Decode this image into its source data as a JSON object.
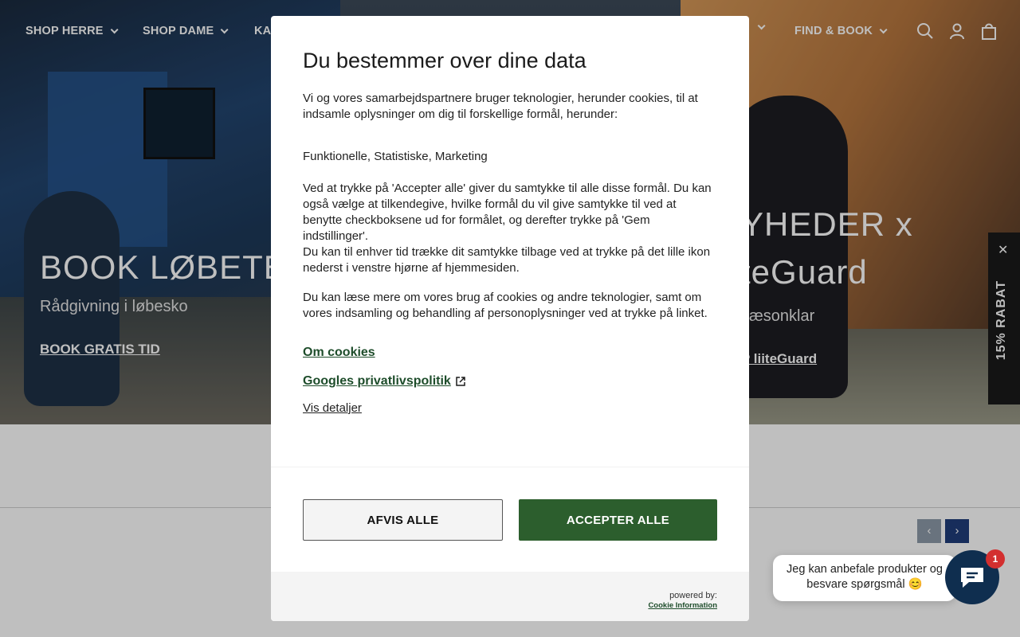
{
  "nav": {
    "items": [
      "SHOP HERRE",
      "SHOP DAME",
      "KA",
      "FIND & BOOK"
    ]
  },
  "hero": {
    "left": {
      "title": "BOOK LØBETES",
      "subtitle": "Rådgivning i løbesko",
      "link": "BOOK GRATIS TID"
    },
    "right": {
      "title_line1": "YHEDER x",
      "title_line2": "teGuard",
      "subtitle": "sæsonklar",
      "link": "P liiteGuard"
    }
  },
  "side_tab": {
    "label": "15% RABAT",
    "close": "✕"
  },
  "carousel": {
    "prev": "‹",
    "next": "›"
  },
  "chat": {
    "bubble": "Jeg kan anbefale produkter og besvare spørgsmål 😊",
    "badge": "1"
  },
  "consent": {
    "title": "Du bestemmer over dine data",
    "intro": "Vi og vores samarbejdspartnere bruger teknologier, herunder cookies, til at indsamle oplysninger om dig til forskellige formål, herunder:",
    "purposes": "Funktionelle, Statistiske, Marketing",
    "accept_info": "Ved at trykke på 'Accepter alle' giver du samtykke til alle disse formål. Du kan også vælge at tilkendegive, hvilke formål du vil give samtykke til ved at benytte checkboksene ud for formålet, og derefter trykke på 'Gem indstillinger'.",
    "withdraw_info": "Du kan til enhver tid trække dit samtykke tilbage ved at trykke på det lille ikon nederst i venstre hjørne af hjemmesiden.",
    "more_info": "Du kan læse mere om vores brug af cookies og andre teknologier, samt om vores indsamling og behandling af personoplysninger ved at trykke på linket.",
    "link_cookies": "Om cookies",
    "link_google": "Googles privatlivspolitik",
    "link_details": "Vis detaljer",
    "btn_reject": "AFVIS ALLE",
    "btn_accept": "ACCEPTER ALLE",
    "powered_by": "powered by:",
    "powered_brand": "Cookie Information"
  }
}
